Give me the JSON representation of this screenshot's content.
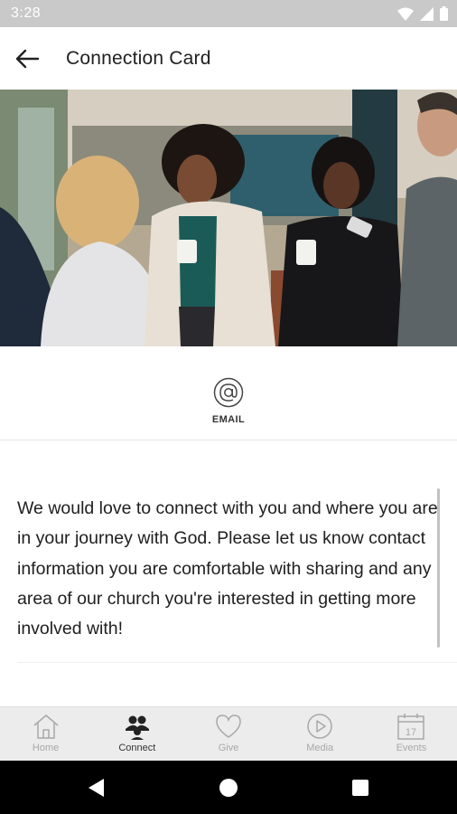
{
  "status_bar": {
    "time": "3:28"
  },
  "app_bar": {
    "title": "Connection Card"
  },
  "action": {
    "email_label": "EMAIL"
  },
  "content": {
    "intro": "We would love to connect with you and where you are in your journey with God. Please let us know contact information you are comfortable with sharing and any area of our church you're interested in getting more involved with!"
  },
  "tabs": [
    {
      "label": "Home",
      "icon": "home-icon",
      "active": false
    },
    {
      "label": "Connect",
      "icon": "people-icon",
      "active": true
    },
    {
      "label": "Give",
      "icon": "heart-icon",
      "active": false
    },
    {
      "label": "Media",
      "icon": "play-circle-icon",
      "active": false
    },
    {
      "label": "Events",
      "icon": "calendar-icon",
      "active": false
    }
  ],
  "events_calendar_day": "17",
  "colors": {
    "status_bar": "#c9c9c9",
    "tab_bar": "#ececec",
    "inactive_tab": "#a8a8a8",
    "active_tab": "#333333"
  }
}
